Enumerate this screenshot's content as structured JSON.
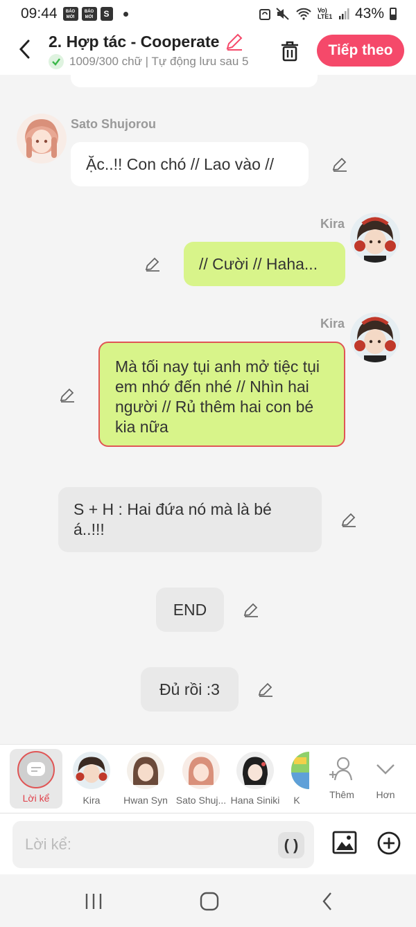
{
  "status_bar": {
    "time": "09:44",
    "app_icon_1": "BÁO MỚI",
    "app_icon_2": "BÁO MỚI",
    "app_icon_3": "S",
    "network": "Vo) LTE1",
    "battery": "43%"
  },
  "header": {
    "title": "2. Hợp tác - Cooperate",
    "subtitle": "1009/300 chữ | Tự động lưu sau 5",
    "next_label": "Tiếp theo"
  },
  "colors": {
    "accent": "#f5496a",
    "green_bubble": "#d8f48a",
    "selected_border": "#e05555"
  },
  "messages": [
    {
      "speaker": "Sato Shujorou",
      "text": "Ặc..!! Con chó // Lao vào //"
    },
    {
      "speaker": "Kira",
      "text": "// Cười // Haha..."
    },
    {
      "speaker": "Kira",
      "text": "Mà tối nay tụi anh mở tiệc tụi em nhớ đến nhé // Nhìn hai người // Rủ thêm hai con bé kia nữa"
    },
    {
      "speaker": "",
      "text": "S + H : Hai đứa nó mà là bé á..!!!"
    },
    {
      "speaker": "",
      "text": "END"
    },
    {
      "speaker": "",
      "text": "Đủ rồi :3"
    }
  ],
  "characters": [
    {
      "label": "Lời kể"
    },
    {
      "label": "Kira"
    },
    {
      "label": "Hwan Syn"
    },
    {
      "label": "Sato Shuj..."
    },
    {
      "label": "Hana Siniki"
    },
    {
      "label": "K"
    }
  ],
  "char_actions": {
    "add_label": "Thêm",
    "more_label": "Hơn"
  },
  "input": {
    "placeholder": "Lời kể:",
    "paren_label": "( )"
  }
}
